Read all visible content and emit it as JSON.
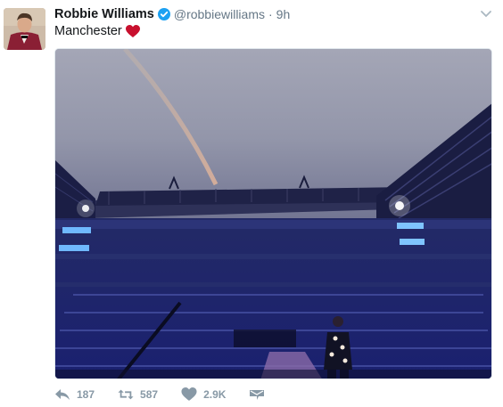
{
  "tweet": {
    "author_name": "Robbie Williams",
    "handle": "@robbiewilliams",
    "separator": "·",
    "time": "9h",
    "text": "Manchester",
    "verified_icon": "verified-badge-icon",
    "emoji_icon": "red-heart-icon"
  },
  "actions": {
    "reply_count": "187",
    "retweet_count": "587",
    "like_count": "2.9K"
  },
  "colors": {
    "text": "#14171a",
    "secondary": "#657786",
    "action_gray": "#8899a6",
    "verified": "#1da1f2",
    "heart": "#c8102e"
  }
}
